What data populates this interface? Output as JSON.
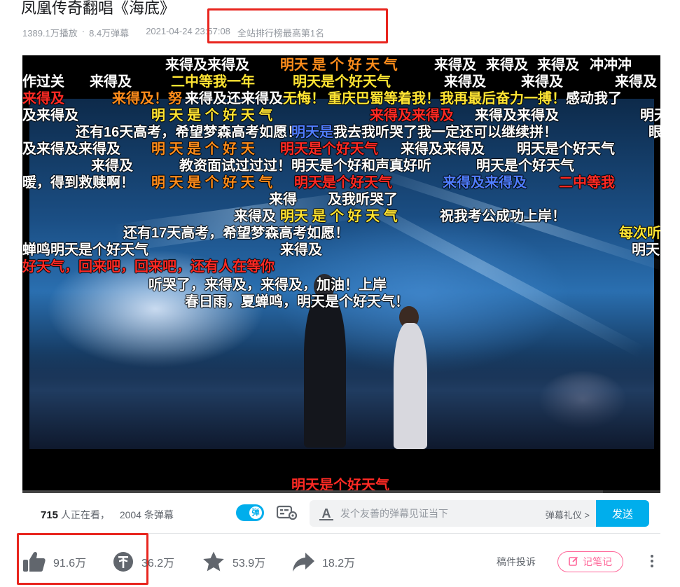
{
  "video": {
    "title": "凤凰传奇翻唱《海底》",
    "plays": "1389.1万播放",
    "separator": "·",
    "danmaku_total": "8.4万弹幕",
    "datetime": "2021-04-24 23:57:08",
    "rank": "全站排行榜最高第1名"
  },
  "player": {
    "danmaku": [
      {
        "text": "来得及来得及",
        "color": "white"
      },
      {
        "text": "明天 是 个 好 天 气",
        "color": "orange"
      },
      {
        "text": "来得及",
        "color": "white"
      },
      {
        "text": "来得及",
        "color": "white"
      },
      {
        "text": "来得及",
        "color": "white"
      },
      {
        "text": "冲冲冲",
        "color": "white"
      },
      {
        "text": "作过关",
        "color": "white"
      },
      {
        "text": "来得及",
        "color": "white"
      },
      {
        "text": "二中等我一年",
        "color": "yellow"
      },
      {
        "text": "明天是个好天气",
        "color": "yellow"
      },
      {
        "text": "来得及",
        "color": "white"
      },
      {
        "text": "来得及",
        "color": "white"
      },
      {
        "text": "来得及",
        "color": "white"
      },
      {
        "text": "来得及",
        "color": "red"
      },
      {
        "text": "来得及！努",
        "color": "orange"
      },
      {
        "text": "来得及还来得及",
        "color": "white"
      },
      {
        "text": "无悔！",
        "color": "yellow"
      },
      {
        "text": "重庆巴蜀等着我！",
        "color": "yellow"
      },
      {
        "text": "我再最后奋力一搏！",
        "color": "yellow"
      },
      {
        "text": "感动我了",
        "color": "white"
      },
      {
        "text": "及来得及",
        "color": "white"
      },
      {
        "text": "明 天 是 个 好 天 气",
        "color": "yellow"
      },
      {
        "text": "来得及来得及",
        "color": "red"
      },
      {
        "text": "来得及来得及",
        "color": "white"
      },
      {
        "text": "明天",
        "color": "white"
      },
      {
        "text": "还有16天高考，希望梦森高考如愿！",
        "color": "white"
      },
      {
        "text": "明天是",
        "color": "blue"
      },
      {
        "text": "我去我听哭了我一定还可以继续拼！",
        "color": "white"
      },
      {
        "text": "眼",
        "color": "white"
      },
      {
        "text": "及来得及来得及",
        "color": "white"
      },
      {
        "text": "明 天 是 个 好 天",
        "color": "orange"
      },
      {
        "text": "明天是个好天气",
        "color": "red"
      },
      {
        "text": "来得及来得及",
        "color": "white"
      },
      {
        "text": "明天是个好天气",
        "color": "white"
      },
      {
        "text": "来得及",
        "color": "white"
      },
      {
        "text": "教资面试过过过！",
        "color": "white"
      },
      {
        "text": "明天是个好和声真好听",
        "color": "white"
      },
      {
        "text": "明天是个好天气",
        "color": "white"
      },
      {
        "text": "暖，得到救赎啊！",
        "color": "white"
      },
      {
        "text": "明 天 是 个 好 天 气",
        "color": "orange"
      },
      {
        "text": "明天是个好天气",
        "color": "red"
      },
      {
        "text": "来得及来得及",
        "color": "blue"
      },
      {
        "text": "二中等我",
        "color": "red"
      },
      {
        "text": "来得",
        "color": "white"
      },
      {
        "text": "及我听哭了",
        "color": "white"
      },
      {
        "text": "来得及",
        "color": "white"
      },
      {
        "text": "明天 是 个 好 天 气",
        "color": "yellow"
      },
      {
        "text": "祝我考公成功上岸！",
        "color": "white"
      },
      {
        "text": "还有17天高考，希望梦森高考如愿！",
        "color": "white"
      },
      {
        "text": "每次听",
        "color": "yellow"
      },
      {
        "text": "蝉鸣明天是个好天气",
        "color": "white"
      },
      {
        "text": "来得及",
        "color": "white"
      },
      {
        "text": "明天",
        "color": "white"
      },
      {
        "text": "好天气，回来吧，回来吧，还有人在等你",
        "color": "red"
      },
      {
        "text": "听哭了，来得及，来得及，加油！上岸",
        "color": "white"
      },
      {
        "text": "春日雨，夏蝉鸣，明天是个好天气！",
        "color": "white"
      },
      {
        "text": "明天是个好天气",
        "color": "red"
      }
    ]
  },
  "danmaku_bar": {
    "viewers_count": "715",
    "viewers_suffix": "人正在看，",
    "danmaku_count": "2004",
    "danmaku_suffix": "条弹幕",
    "toggle_label": "弹",
    "input_placeholder": "发个友善的弹幕见证当下",
    "etiquette": "弹幕礼仪 >",
    "send_label": "发送"
  },
  "actions": {
    "like": "91.6万",
    "coin": "36.2万",
    "favorite": "53.9万",
    "share": "18.2万",
    "report": "稿件投诉",
    "note": "记笔记"
  },
  "colors": {
    "accent": "#00aeec",
    "highlight": "#e8251e",
    "note": "#ff6699"
  }
}
